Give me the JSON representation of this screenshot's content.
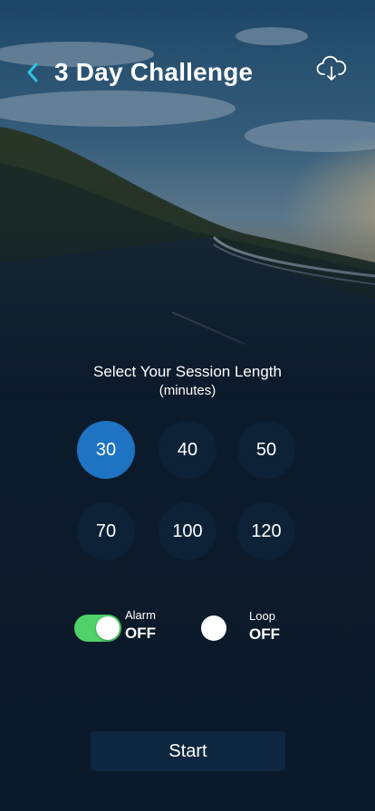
{
  "header": {
    "title": "3 Day Challenge",
    "back_icon": "chevron-left-icon",
    "download_icon": "cloud-download-icon",
    "accent_color": "#2bc4e8"
  },
  "session": {
    "prompt": "Select Your Session Length",
    "unit": "(minutes)",
    "options": [
      "30",
      "40",
      "50",
      "70",
      "100",
      "120"
    ],
    "selected": "30",
    "selected_color": "#1e73c2"
  },
  "alarm": {
    "label": "Alarm",
    "state": "OFF"
  },
  "loop": {
    "label": "Loop",
    "state": "OFF"
  },
  "start_label": "Start"
}
